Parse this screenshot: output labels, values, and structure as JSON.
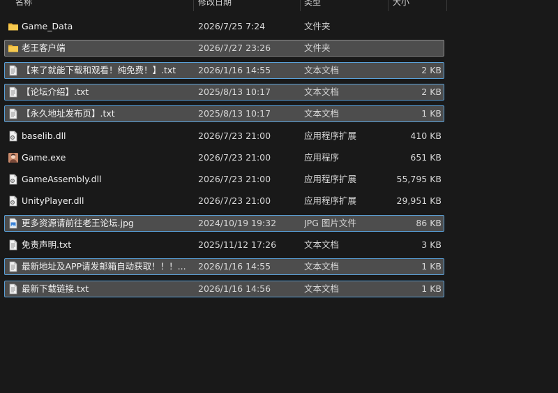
{
  "columns": {
    "name": "名称",
    "date": "修改日期",
    "type": "类型",
    "size": "大小"
  },
  "files": [
    {
      "name": "Game_Data",
      "date": "2026/7/25 7:24",
      "type": "文件夹",
      "size": "",
      "icon": "folder-icon",
      "selected": false
    },
    {
      "name": "老王客户端",
      "date": "2026/7/27 23:26",
      "type": "文件夹",
      "size": "",
      "icon": "folder-icon",
      "selected": true
    },
    {
      "name": "【来了就能下载和观看！纯免费！】.txt",
      "date": "2026/1/16 14:55",
      "type": "文本文档",
      "size": "2 KB",
      "icon": "text-file-icon",
      "selected": true
    },
    {
      "name": "【论坛介绍】.txt",
      "date": "2025/8/13 10:17",
      "type": "文本文档",
      "size": "2 KB",
      "icon": "text-file-icon",
      "selected": true
    },
    {
      "name": "【永久地址发布页】.txt",
      "date": "2025/8/13 10:17",
      "type": "文本文档",
      "size": "1 KB",
      "icon": "text-file-icon",
      "selected": true
    },
    {
      "name": "baselib.dll",
      "date": "2026/7/23 21:00",
      "type": "应用程序扩展",
      "size": "410 KB",
      "icon": "dll-file-icon",
      "selected": false
    },
    {
      "name": "Game.exe",
      "date": "2026/7/23 21:00",
      "type": "应用程序",
      "size": "651 KB",
      "icon": "exe-app-icon",
      "selected": false
    },
    {
      "name": "GameAssembly.dll",
      "date": "2026/7/23 21:00",
      "type": "应用程序扩展",
      "size": "55,795 KB",
      "icon": "dll-file-icon",
      "selected": false
    },
    {
      "name": "UnityPlayer.dll",
      "date": "2026/7/23 21:00",
      "type": "应用程序扩展",
      "size": "29,951 KB",
      "icon": "dll-file-icon",
      "selected": false
    },
    {
      "name": "更多资源请前往老王论坛.jpg",
      "date": "2024/10/19 19:32",
      "type": "JPG 图片文件",
      "size": "86 KB",
      "icon": "image-file-icon",
      "selected": true
    },
    {
      "name": "免责声明.txt",
      "date": "2025/11/12 17:26",
      "type": "文本文档",
      "size": "3 KB",
      "icon": "text-file-icon",
      "selected": false
    },
    {
      "name": "最新地址及APP请发邮箱自动获取！！！...",
      "date": "2026/1/16 14:55",
      "type": "文本文档",
      "size": "1 KB",
      "icon": "text-file-icon",
      "selected": true
    },
    {
      "name": "最新下载链接.txt",
      "date": "2026/1/16 14:56",
      "type": "文本文档",
      "size": "1 KB",
      "icon": "text-file-icon",
      "selected": true
    }
  ],
  "colors": {
    "background": "#191919",
    "selection_fill": "#4d4d4d",
    "selection_border": "#5aa0d8",
    "folder": "#f4c245"
  }
}
